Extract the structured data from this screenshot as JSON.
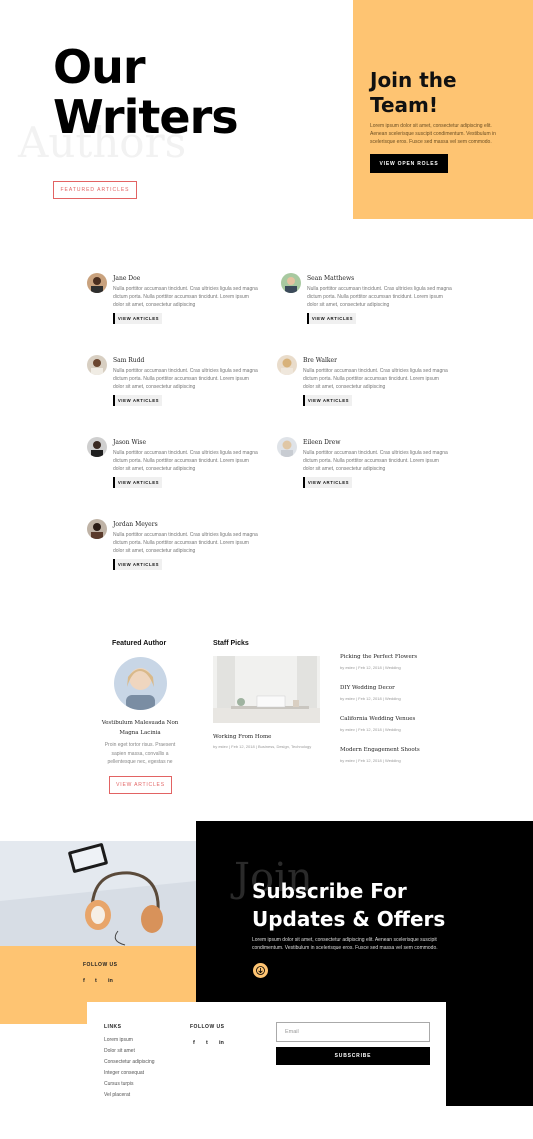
{
  "hero": {
    "title_line1": "Our",
    "title_line2": "Writers",
    "ghost_text": "Authors",
    "featured_button": "FEATURED ARTICLES"
  },
  "join": {
    "title_line1": "Join the",
    "title_line2": "Team!",
    "text": "Lorem ipsum dolor sit amet, consectetur adipiscing elit. Aenean scelerisque suscipit condimentum. Vestibulum in scelerisque eros. Fusce sed massa vel sem commodo.",
    "button": "VIEW OPEN ROLES",
    "accent_color": "#fec472"
  },
  "authors": [
    {
      "name": "Jane Doe",
      "bio": "Nulla porttitor accumsan tincidunt. Cras ultricies ligula sed magna dictum porta. Nulla porttitor accumsan tincidunt. Lorem ipsum dolor sit amet, consectetur adipiscing",
      "button": "VIEW ARTICLES"
    },
    {
      "name": "Sean Matthews",
      "bio": "Nulla porttitor accumsan tincidunt. Cras ultricies ligula sed magna dictum porta. Nulla porttitor accumsan tincidunt. Lorem ipsum dolor sit amet, consectetur adipiscing",
      "button": "VIEW ARTICLES"
    },
    {
      "name": "Sam Rudd",
      "bio": "Nulla porttitor accumsan tincidunt. Cras ultricies ligula sed magna dictum porta. Nulla porttitor accumsan tincidunt. Lorem ipsum dolor sit amet, consectetur adipiscing",
      "button": "VIEW ARTICLES"
    },
    {
      "name": "Bre Walker",
      "bio": "Nulla porttitor accumsan tincidunt. Cras ultricies ligula sed magna dictum porta. Nulla porttitor accumsan tincidunt. Lorem ipsum dolor sit amet, consectetur adipiscing",
      "button": "VIEW ARTICLES"
    },
    {
      "name": "Jason Wise",
      "bio": "Nulla porttitor accumsan tincidunt. Cras ultricies ligula sed magna dictum porta. Nulla porttitor accumsan tincidunt. Lorem ipsum dolor sit amet, consectetur adipiscing",
      "button": "VIEW ARTICLES"
    },
    {
      "name": "Eileen Drew",
      "bio": "Nulla porttitor accumsan tincidunt. Cras ultricies ligula sed magna dictum porta. Nulla porttitor accumsan tincidunt. Lorem ipsum dolor sit amet, consectetur adipiscing",
      "button": "VIEW ARTICLES"
    },
    {
      "name": "Jordan Meyers",
      "bio": "Nulla porttitor accumsan tincidunt. Cras ultricies ligula sed magna dictum porta. Nulla porttitor accumsan tincidunt. Lorem ipsum dolor sit amet, consectetur adipiscing",
      "button": "VIEW ARTICLES"
    }
  ],
  "featured": {
    "heading": "Featured Author",
    "name_line1": "Vestibulum Malesuada Non",
    "name_line2": "Magna Lacinia",
    "bio": "Proin eget tortor risus. Praesent sapien massa, convallis a pellentesque nec, egestas ne",
    "button": "VIEW ARTICLES"
  },
  "staff": {
    "heading": "Staff Picks",
    "main_title": "Working From Home",
    "main_meta": "by estev | Feb 12, 2018 | Business, Design, Technology",
    "posts": [
      {
        "title": "Picking the Perfect Flowers",
        "meta": "by estev | Feb 12, 2018 | Wedding"
      },
      {
        "title": "DIY Wedding Decor",
        "meta": "by estev | Feb 12, 2018 | Wedding"
      },
      {
        "title": "California Wedding Venues",
        "meta": "by estev | Feb 12, 2018 | Wedding"
      },
      {
        "title": "Modern Engagement Shoots",
        "meta": "by estev | Feb 12, 2018 | Wedding"
      }
    ]
  },
  "subscribe": {
    "ghost_text": "Join",
    "title_line1": "Subscribe For",
    "title_line2": "Updates & Offers",
    "text": "Lorem ipsum dolor sit amet, consectetur adipiscing elit. Aenean scelerisque suscipit condimentum. Vestibulum in scelerisque eros. Fusce sed massa vel sem commodo."
  },
  "follow_left": {
    "heading": "FOLLOW US",
    "icons": [
      "f",
      "t",
      "in"
    ]
  },
  "footer": {
    "links_heading": "LINKS",
    "links": [
      "Lorem ipsum",
      "Dolor sit amet",
      "Consectetur adipiscing",
      "Integer consequat",
      "Cursus turpis",
      "Vel placerat"
    ],
    "follow_heading": "FOLLOW US",
    "follow_icons": [
      "f",
      "t",
      "in"
    ],
    "email_placeholder": "Email",
    "subscribe_button": "SUBSCRIBE"
  }
}
